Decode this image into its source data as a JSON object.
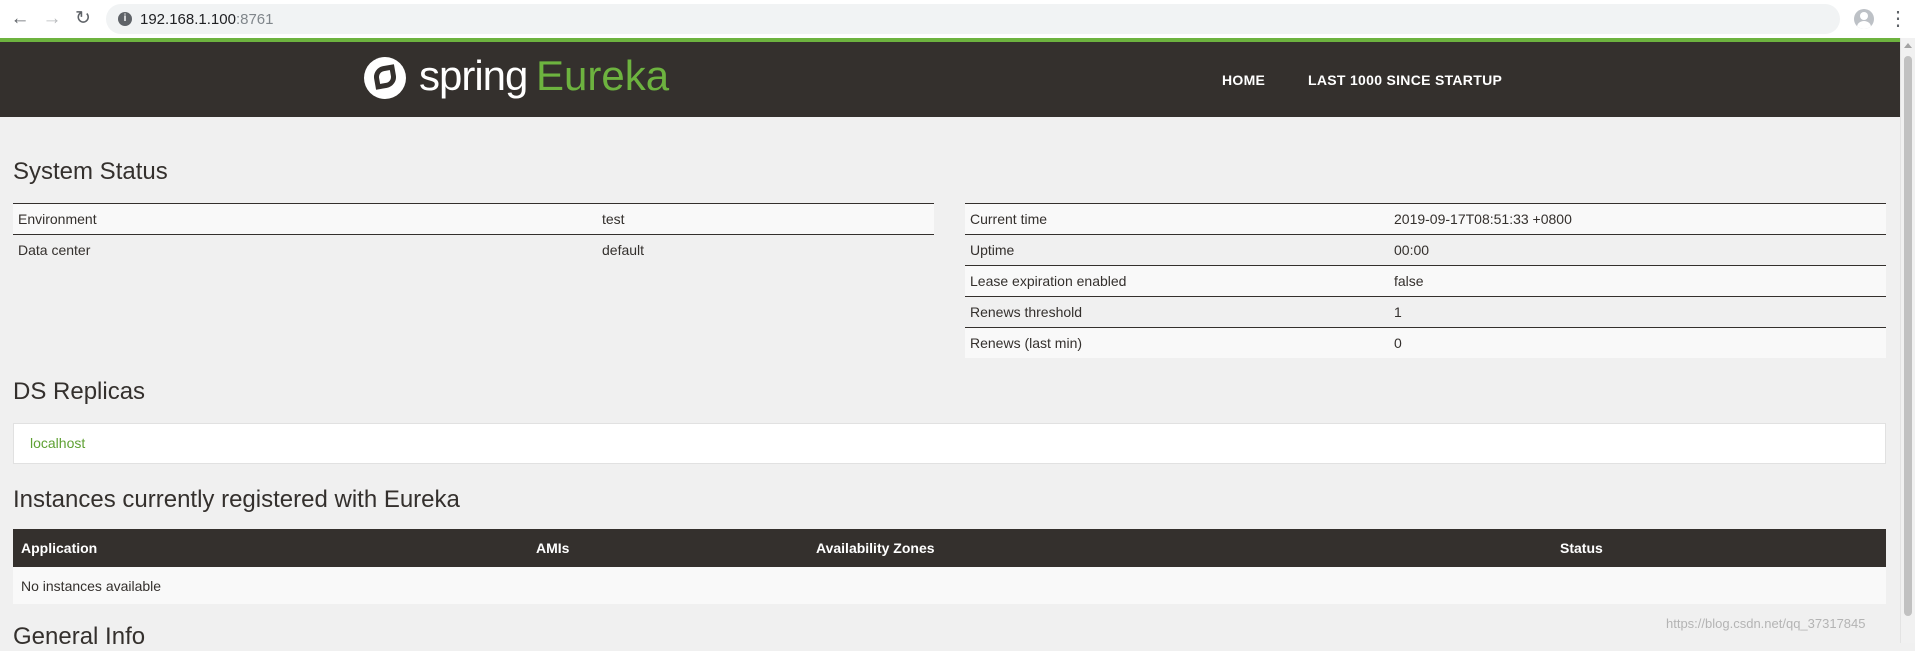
{
  "browser": {
    "back_icon": "arrow-left-icon",
    "forward_icon": "arrow-right-icon",
    "reload_icon": "reload-icon",
    "url_host": "192.168.1.100",
    "url_port": ":8761"
  },
  "header": {
    "logo_spring": "spring",
    "logo_eureka": "Eureka",
    "nav_home": "HOME",
    "nav_last1000": "LAST 1000 SINCE STARTUP"
  },
  "system_status": {
    "title": "System Status",
    "left": [
      {
        "label": "Environment",
        "value": "test"
      },
      {
        "label": "Data center",
        "value": "default"
      }
    ],
    "right": [
      {
        "label": "Current time",
        "value": "2019-09-17T08:51:33 +0800"
      },
      {
        "label": "Uptime",
        "value": "00:00"
      },
      {
        "label": "Lease expiration enabled",
        "value": "false"
      },
      {
        "label": "Renews threshold",
        "value": "1"
      },
      {
        "label": "Renews (last min)",
        "value": "0"
      }
    ]
  },
  "ds_replicas": {
    "title": "DS Replicas",
    "items": [
      "localhost"
    ]
  },
  "instances": {
    "title": "Instances currently registered with Eureka",
    "columns": [
      "Application",
      "AMIs",
      "Availability Zones",
      "Status"
    ],
    "empty_text": "No instances available"
  },
  "general_info": {
    "title": "General Info"
  },
  "watermark": "https://blog.csdn.net/qq_37317845",
  "colors": {
    "brand_green": "#6db33f",
    "header_dark": "#34302d",
    "page_bg": "#f0f0f0"
  }
}
